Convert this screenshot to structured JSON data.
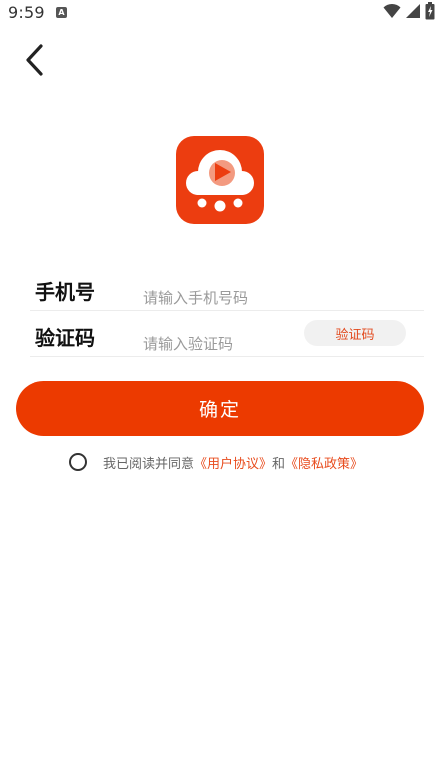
{
  "status_bar": {
    "time": "9:59",
    "app_icon_letter": "A",
    "icons": [
      "wifi-icon",
      "signal-icon",
      "battery-icon"
    ]
  },
  "header": {
    "back_icon": "chevron-left-icon"
  },
  "logo": {
    "icon": "video-cloud-logo-icon",
    "brand_color": "#ec3d10"
  },
  "form": {
    "phone_label": "手机号",
    "phone_placeholder": "请输入手机号码",
    "phone_value": "",
    "code_label": "验证码",
    "code_placeholder": "请输入验证码",
    "code_value": "",
    "code_button_label": "验证码"
  },
  "confirm": {
    "label": "确定",
    "color": "#ec3a00"
  },
  "agreement": {
    "checked": false,
    "prefix": "我已阅读并同意",
    "user_agreement": "《用户协议》",
    "connector": "和",
    "privacy_policy": "《隐私政策》",
    "link_color": "#e84c1e"
  }
}
